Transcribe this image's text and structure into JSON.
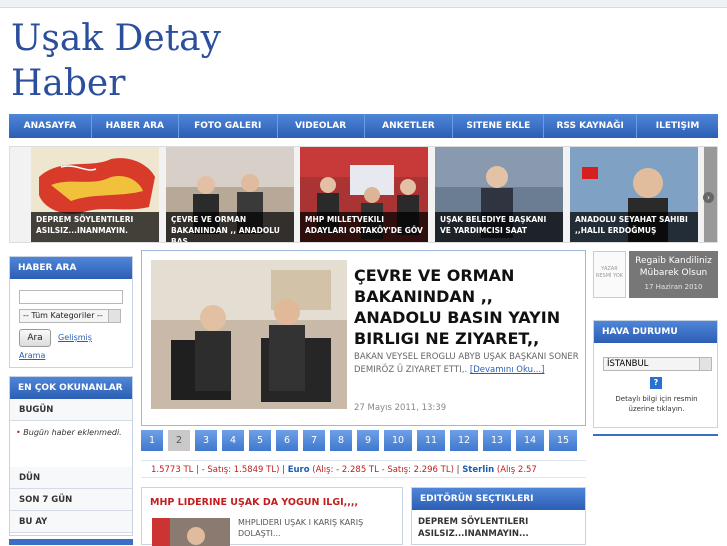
{
  "site": {
    "title_line1": "Uşak Detay",
    "title_line2": "Haber"
  },
  "nav": [
    "ANASAYFA",
    "HABER ARA",
    "FOTO GALERI",
    "VIDEOLAR",
    "ANKETLER",
    "SITENE EKLE",
    "RSS KAYNAĞI",
    "ILETIŞIM"
  ],
  "slider": [
    {
      "caption": "DEPREM SÖYLENTILERI ASILSIZ...INANMAYIN."
    },
    {
      "caption": "ÇEVRE VE ORMAN BAKANINDAN ,, ANADOLU BAS"
    },
    {
      "caption": "MHP MILLETVEKILI ADAYLARI ORTAKÖY'DE GÖV"
    },
    {
      "caption": "UŞAK BELEDIYE BAŞKANI VE YARDIMCISI SAAT"
    },
    {
      "caption": "ANADOLU SEYAHAT SAHIBI ,,HALIL ERDOĞMUŞ"
    }
  ],
  "search": {
    "header": "HABER ARA",
    "category": "-- Tüm Kategoriler --",
    "button": "Ara",
    "advanced": "Gelişmiş",
    "search_link": "Arama"
  },
  "most_read": {
    "header": "EN ÇOK OKUNANLAR",
    "tabs": [
      "BUGÜN",
      "DÜN",
      "SON 7 GÜN",
      "BU AY"
    ],
    "empty_message": "Bugün haber eklenmedi."
  },
  "feature": {
    "title": "ÇEVRE VE ORMAN BAKANINDAN ,, ANADOLU BASIN YAYIN BIRLIGI NE ZIYARET,,",
    "desc": "BAKAN VEYSEL EROGLU ABYB UŞAK BAŞKANI SONER DEMIRÖZ Ü ZIYARET ETTI,.",
    "more": "[Devamını Oku...]",
    "date": "27 Mayıs 2011, 13:39"
  },
  "pager": [
    "1",
    "2",
    "3",
    "4",
    "5",
    "6",
    "7",
    "8",
    "9",
    "10",
    "11",
    "12",
    "13",
    "14",
    "15"
  ],
  "pager_active": "2",
  "ticker": {
    "t1": "1.5773 TL",
    "t2": "| - Satış: 1.5849 TL)",
    "t3": "|",
    "t4": "Euro",
    "t5": "(Alış: - 2.285 TL - Satış: 2.296 TL)",
    "t6": "|",
    "t7": "Sterlin",
    "t8": "(Alış 2.57"
  },
  "news_left": {
    "header": "MHP LIDERINE UŞAK DA YOGUN ILGI,,,,",
    "text": "MHPLIDERI UŞAK I KARIŞ KARIŞ DOLAŞTI..."
  },
  "editor": {
    "header": "EDITÖRÜN SEÇTIKLERI",
    "item": "DEPREM SÖYLENTILERI ASILSIZ...INANMAYIN..."
  },
  "notice": {
    "no_image": "YAZAR RESMİ YOK",
    "text": "Regaib Kandiliniz Mübarek Olsun",
    "date": "17 Haziran 2010"
  },
  "weather": {
    "header": "HAVA DURUMU",
    "city": "İSTANBUL",
    "hint": "Detaylı bilgi için resmin üzerine tıklayın."
  },
  "colors": {
    "nav_blue": "#3a6fc6",
    "link_red": "#c41d1d",
    "title_blue": "#2b4f9c"
  }
}
